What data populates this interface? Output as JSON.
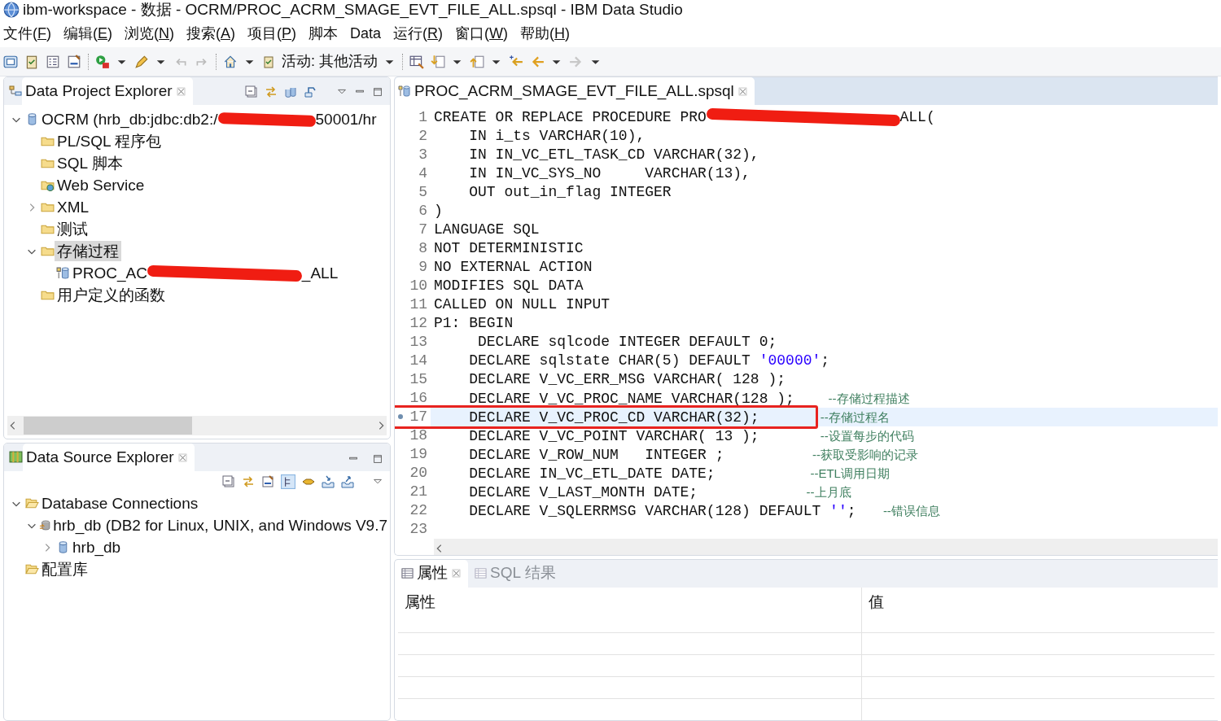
{
  "window": {
    "title": "ibm-workspace - 数据 - OCRM/PROC_ACRM_SMAGE_EVT_FILE_ALL.spsql - IBM Data Studio"
  },
  "menu": [
    {
      "before": "文件(",
      "key": "F",
      "after": ")"
    },
    {
      "before": "编辑(",
      "key": "E",
      "after": ")"
    },
    {
      "before": "浏览(",
      "key": "N",
      "after": ")"
    },
    {
      "before": "搜索(",
      "key": "A",
      "after": ")"
    },
    {
      "before": "项目(",
      "key": "P",
      "after": ")"
    },
    {
      "before": "脚本"
    },
    {
      "before": "Data"
    },
    {
      "before": "运行(",
      "key": "R",
      "after": ")"
    },
    {
      "before": "窗口(",
      "key": "W",
      "after": ")"
    },
    {
      "before": "帮助(",
      "key": "H",
      "after": ")"
    }
  ],
  "toolbar": {
    "activity": "活动:  其他活动"
  },
  "project_explorer": {
    "tab": "Data Project Explorer",
    "tree": [
      {
        "kind": "database",
        "label": "OCRM (hrb_db:jdbc:db2:/",
        "label_after_redaction": "50001/hr",
        "expanded": true,
        "selected": false,
        "children": [
          {
            "kind": "folder",
            "label": "PL/SQL 程序包",
            "selected": false
          },
          {
            "kind": "folder",
            "label": "SQL 脚本",
            "selected": false
          },
          {
            "kind": "web-folder",
            "label": "Web Service",
            "selected": false
          },
          {
            "kind": "folder",
            "label": "XML",
            "expanded": false,
            "selected": false
          },
          {
            "kind": "folder",
            "label": "测试",
            "selected": false
          },
          {
            "kind": "folder",
            "label": "存储过程",
            "expanded": true,
            "selected": true,
            "children": [
              {
                "kind": "procedure",
                "label": "PROC_AC",
                "label_after_redaction": "_ALL",
                "selected": false
              }
            ]
          },
          {
            "kind": "folder",
            "label": "用户定义的函数",
            "selected": false
          }
        ]
      }
    ]
  },
  "source_explorer": {
    "tab": "Data Source Explorer",
    "tree": [
      {
        "kind": "open-folder",
        "label": "Database Connections",
        "expanded": true,
        "selected": false,
        "children": [
          {
            "kind": "connection",
            "label": "hrb_db (DB2 for Linux, UNIX, and Windows V9.7",
            "expanded": true,
            "selected": false,
            "children": [
              {
                "kind": "database",
                "label": "hrb_db",
                "expanded": false,
                "selected": false
              }
            ]
          }
        ]
      },
      {
        "kind": "open-folder",
        "label": "配置库",
        "selected": false
      }
    ]
  },
  "editor": {
    "tab": "PROC_ACRM_SMAGE_EVT_FILE_ALL.spsql",
    "lines": [
      {
        "n": "1",
        "current": false,
        "boxed": false,
        "parts": [
          {
            "kind": "code",
            "text": "CREATE OR REPLACE PROCEDURE PRO"
          },
          {
            "kind": "redacted"
          },
          {
            "kind": "code",
            "text": "ALL("
          }
        ]
      },
      {
        "n": "2",
        "current": false,
        "boxed": false,
        "parts": [
          {
            "kind": "code",
            "text": "    IN i_ts VARCHAR(10),"
          }
        ]
      },
      {
        "n": "3",
        "current": false,
        "boxed": false,
        "parts": [
          {
            "kind": "code",
            "text": "    IN IN_VC_ETL_TASK_CD VARCHAR(32),"
          }
        ]
      },
      {
        "n": "4",
        "current": false,
        "boxed": false,
        "parts": [
          {
            "kind": "code",
            "text": "    IN IN_VC_SYS_NO     VARCHAR(13),"
          }
        ]
      },
      {
        "n": "5",
        "current": false,
        "boxed": false,
        "parts": [
          {
            "kind": "code",
            "text": "    OUT out_in_flag INTEGER"
          }
        ]
      },
      {
        "n": "6",
        "current": false,
        "boxed": false,
        "parts": [
          {
            "kind": "code",
            "text": ")"
          }
        ]
      },
      {
        "n": "7",
        "current": false,
        "boxed": false,
        "parts": [
          {
            "kind": "code",
            "text": "LANGUAGE SQL"
          }
        ]
      },
      {
        "n": "8",
        "current": false,
        "boxed": false,
        "parts": [
          {
            "kind": "code",
            "text": "NOT DETERMINISTIC"
          }
        ]
      },
      {
        "n": "9",
        "current": false,
        "boxed": false,
        "parts": [
          {
            "kind": "code",
            "text": "NO EXTERNAL ACTION"
          }
        ]
      },
      {
        "n": "10",
        "current": false,
        "boxed": false,
        "parts": [
          {
            "kind": "code",
            "text": "MODIFIES SQL DATA"
          }
        ]
      },
      {
        "n": "11",
        "current": false,
        "boxed": false,
        "parts": [
          {
            "kind": "code",
            "text": "CALLED ON NULL INPUT"
          }
        ]
      },
      {
        "n": "12",
        "current": false,
        "boxed": false,
        "parts": [
          {
            "kind": "code",
            "text": "P1: BEGIN"
          }
        ]
      },
      {
        "n": "13",
        "current": false,
        "boxed": false,
        "parts": [
          {
            "kind": "code",
            "text": "     DECLARE sqlcode INTEGER DEFAULT 0;"
          }
        ]
      },
      {
        "n": "14",
        "current": false,
        "boxed": false,
        "parts": [
          {
            "kind": "code",
            "text": "    DECLARE sqlstate CHAR(5) DEFAULT "
          },
          {
            "kind": "string",
            "text": "'00000'"
          },
          {
            "kind": "code",
            "text": ";"
          }
        ]
      },
      {
        "n": "15",
        "current": false,
        "boxed": false,
        "parts": [
          {
            "kind": "code",
            "text": "    DECLARE V_VC_ERR_MSG VARCHAR( 128 );"
          }
        ]
      },
      {
        "n": "16",
        "current": false,
        "boxed": false,
        "parts": [
          {
            "kind": "code",
            "text": "    DECLARE V_VC_PROC_NAME VARCHAR(128 );"
          },
          {
            "kind": "comment",
            "text": "--存储过程描述"
          }
        ]
      },
      {
        "n": "17",
        "current": true,
        "boxed": true,
        "parts": [
          {
            "kind": "code",
            "text": "    DECLARE V_VC_PROC_CD VARCHAR(32);"
          },
          {
            "kind": "comment",
            "text": "--存储过程名"
          }
        ]
      },
      {
        "n": "18",
        "current": false,
        "boxed": false,
        "parts": [
          {
            "kind": "code",
            "text": "    DECLARE V_VC_POINT VARCHAR( 13 );"
          },
          {
            "kind": "comment",
            "text": "--设置每步的代码"
          }
        ]
      },
      {
        "n": "19",
        "current": false,
        "boxed": false,
        "parts": [
          {
            "kind": "code",
            "text": "    DECLARE V_ROW_NUM   INTEGER ;"
          },
          {
            "kind": "comment",
            "text": "--获取受影响的记录"
          }
        ]
      },
      {
        "n": "20",
        "current": false,
        "boxed": false,
        "parts": [
          {
            "kind": "code",
            "text": "    DECLARE IN_VC_ETL_DATE DATE;"
          },
          {
            "kind": "comment",
            "text": "--ETL调用日期"
          }
        ]
      },
      {
        "n": "21",
        "current": false,
        "boxed": false,
        "parts": [
          {
            "kind": "code",
            "text": "    DECLARE V_LAST_MONTH DATE;"
          },
          {
            "kind": "comment",
            "text": "--上月底"
          }
        ]
      },
      {
        "n": "22",
        "current": false,
        "boxed": false,
        "parts": [
          {
            "kind": "code",
            "text": "    DECLARE V_SQLERRMSG VARCHAR(128) DEFAULT "
          },
          {
            "kind": "string",
            "text": "''"
          },
          {
            "kind": "code",
            "text": ";"
          },
          {
            "kind": "comment",
            "text": "--错误信息"
          }
        ]
      },
      {
        "n": "23",
        "current": false,
        "boxed": false
      }
    ]
  },
  "properties": {
    "tabs": [
      {
        "label": "属性",
        "selected": true
      },
      {
        "label": "SQL 结果",
        "selected": false
      }
    ],
    "columns": [
      "属性",
      "值"
    ]
  }
}
